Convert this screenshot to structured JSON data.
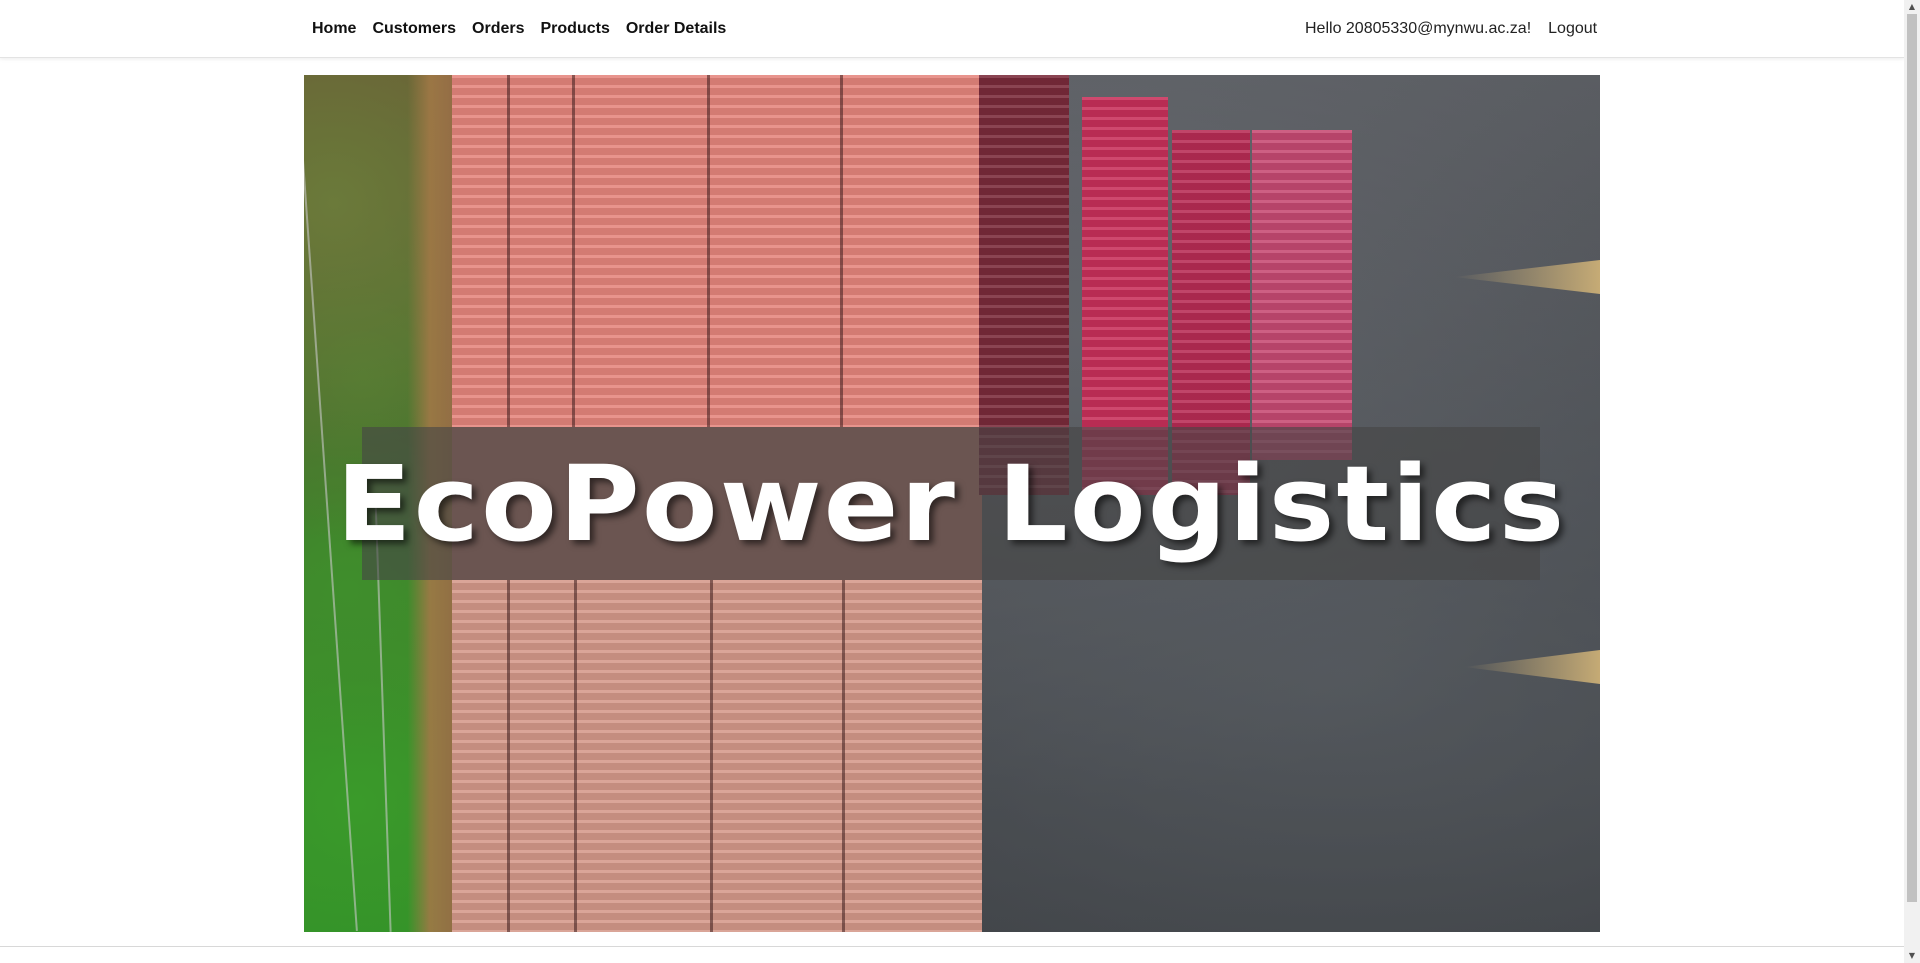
{
  "navbar": {
    "links": [
      {
        "label": "Home"
      },
      {
        "label": "Customers"
      },
      {
        "label": "Orders"
      },
      {
        "label": "Products"
      },
      {
        "label": "Order Details"
      }
    ],
    "greeting": "Hello 20805330@mynwu.ac.za!",
    "logout_label": "Logout"
  },
  "hero": {
    "title": "EcoPower Logistics"
  },
  "scrollbar": {
    "up_icon": "▲",
    "down_icon": "▼"
  },
  "colors": {
    "container_salmon": "#e77c78",
    "container_pink": "#c42a57",
    "container_tan": "#d8a08c",
    "asphalt": "#4a4d52"
  }
}
